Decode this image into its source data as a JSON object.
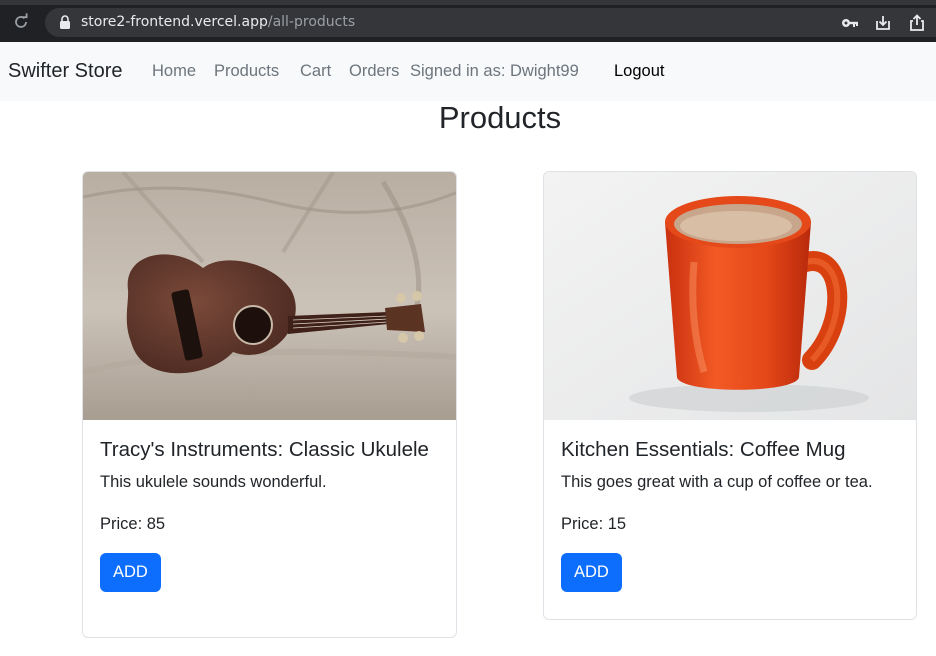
{
  "browser": {
    "url_host": "store2-frontend.vercel.app",
    "url_path": "/all-products",
    "icons": [
      "reload-icon",
      "lock-icon",
      "key-icon",
      "install-icon",
      "share-icon"
    ]
  },
  "navbar": {
    "brand": "Swifter Store",
    "links": [
      "Home",
      "Products",
      "Cart",
      "Orders"
    ],
    "signed_in": "Signed in as: Dwight99",
    "logout": "Logout"
  },
  "page": {
    "title": "Products"
  },
  "products": [
    {
      "title": "Tracy's Instruments: Classic Ukulele",
      "description": "This ukulele sounds wonderful.",
      "price": "Price: 85",
      "button": "ADD",
      "image": "ukulele-on-couch"
    },
    {
      "title": "Kitchen Essentials: Coffee Mug",
      "description": "This goes great with a cup of coffee or tea.",
      "price": "Price: 15",
      "button": "ADD",
      "image": "orange-coffee-mug"
    }
  ],
  "colors": {
    "chrome_bg": "#202124",
    "navbar_bg": "#f8f9fa",
    "button_primary": "#0d6efd",
    "muted_link": "#6c757d"
  }
}
